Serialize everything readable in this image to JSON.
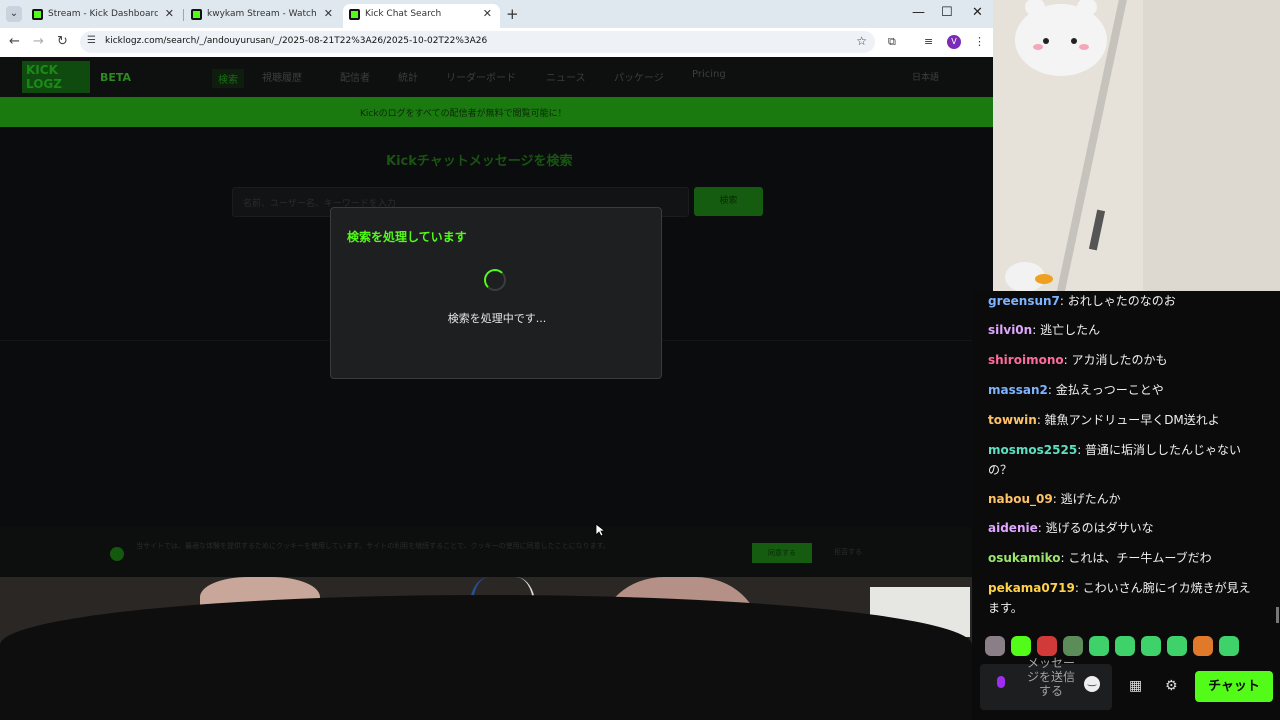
{
  "browser": {
    "tabs": [
      {
        "title": "Stream - Kick Dashboard",
        "active": false
      },
      {
        "title": "kwykam Stream - Watch Live o",
        "active": false
      },
      {
        "title": "Kick Chat Search",
        "active": true
      }
    ],
    "url": "kicklogz.com/search/_/andouyurusan/_/2025-08-21T22%3A26/2025-10-02T22%3A26",
    "profile_initial": "V"
  },
  "site": {
    "logo": "KICK LOGZ",
    "beta": "BETA",
    "nav": [
      "検索",
      "視聴履歴",
      "配信者",
      "統計",
      "リーダーボード",
      "ニュース",
      "パッケージ",
      "Pricing"
    ],
    "lang": "日本語",
    "banner": "Kickのログをすべての配信者が無料で閲覧可能に！",
    "heading": "Kickチャットメッセージを検索",
    "search_placeholder": "名前、ユーザー名、キーワードを入力",
    "search_button": "検索",
    "cookie_text": "当サイトでは、最適な体験を提供するためにクッキーを使用しています。サイトの利用を継続することで、クッキーの使用に同意したことになります。",
    "cookie_accept": "同意する",
    "cookie_decline": "拒否する"
  },
  "modal": {
    "title": "検索を処理しています",
    "message": "検索を処理中です..."
  },
  "chat": {
    "messages": [
      {
        "user": "greensun7",
        "text": "おれしゃたのなのお",
        "color": "#7fb3ff"
      },
      {
        "user": "silvi0n",
        "text": "逃亡したん",
        "color": "#e1a6ff"
      },
      {
        "user": "shiroimono",
        "text": "アカ消したのかも",
        "color": "#ff6b9d"
      },
      {
        "user": "massan2",
        "text": "金払えっつーことや",
        "color": "#7fb3ff"
      },
      {
        "user": "towwin",
        "text": "雑魚アンドリュー早くDM送れよ",
        "color": "#ffc266"
      },
      {
        "user": "mosmos2525",
        "text": "普通に垢消ししたんじゃないの？",
        "color": "#5ee0c0"
      },
      {
        "user": "nabou_09",
        "text": "逃げたんか",
        "color": "#ffc266"
      },
      {
        "user": "aidenie",
        "text": "逃げるのはダサいな",
        "color": "#e1a6ff"
      },
      {
        "user": "osukamiko",
        "text": "これは、チー牛ムーブだわ",
        "color": "#9be56a"
      },
      {
        "user": "pekama0719",
        "text": "こわいさん腕にイカ焼きが見えます。",
        "color": "#ffd24a"
      }
    ],
    "placeholder": "メッセージを送信する",
    "send_label": "チャット",
    "emote_colors": [
      "#8a7f86",
      "#53fc18",
      "#d23a3a",
      "#5c8c5a",
      "#3fd26a",
      "#3fd26a",
      "#3fd26a",
      "#3fd26a",
      "#e07a2a",
      "#3fd26a"
    ]
  }
}
